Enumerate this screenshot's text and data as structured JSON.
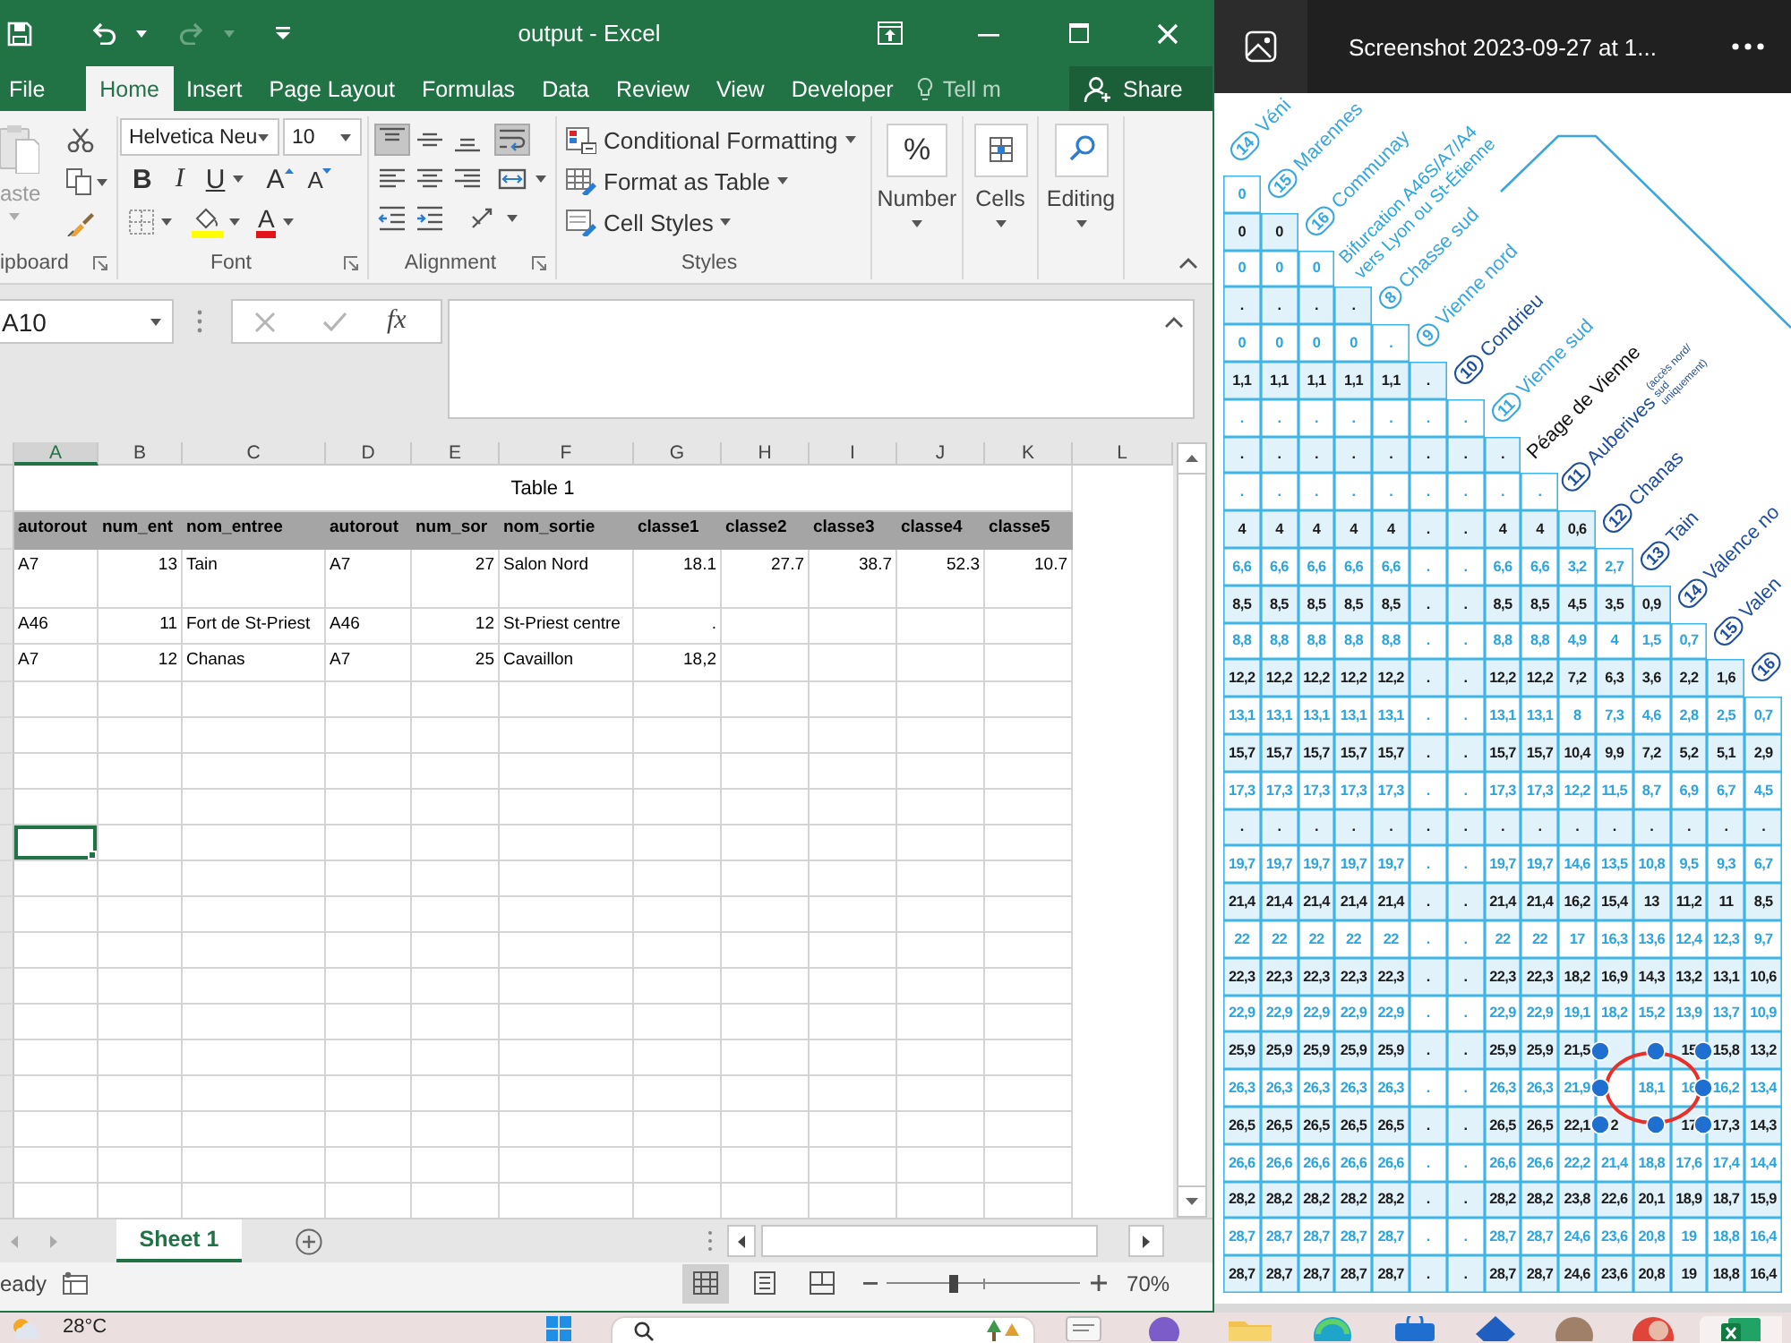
{
  "excel": {
    "title": "output - Excel",
    "tabs": [
      {
        "label": "File",
        "selected": false
      },
      {
        "label": "Home",
        "selected": true
      },
      {
        "label": "Insert",
        "selected": false
      },
      {
        "label": "Page Layout",
        "selected": false
      },
      {
        "label": "Formulas",
        "selected": false
      },
      {
        "label": "Data",
        "selected": false
      },
      {
        "label": "Review",
        "selected": false
      },
      {
        "label": "View",
        "selected": false
      },
      {
        "label": "Developer",
        "selected": false
      }
    ],
    "tell_me": "Tell m",
    "share": "Share",
    "clipboard": {
      "paste": "aste",
      "label": "ipboard"
    },
    "font": {
      "name": "Helvetica Neu",
      "size": "10",
      "bold": "B",
      "italic": "I",
      "underline": "U",
      "grow": "A",
      "shrink": "A",
      "font_color_button": "A",
      "label": "Font"
    },
    "alignment": {
      "buttons": [
        {
          "kind": "top",
          "selected": true
        },
        {
          "kind": "middle",
          "selected": false
        },
        {
          "kind": "bottom",
          "selected": false
        },
        {
          "kind": "wrap",
          "selected": true
        },
        {
          "kind": "left",
          "selected": false
        },
        {
          "kind": "center",
          "selected": false
        },
        {
          "kind": "right",
          "selected": false
        },
        {
          "kind": "merge",
          "selected": false
        },
        {
          "kind": "outdent",
          "selected": false
        },
        {
          "kind": "indent",
          "selected": false
        },
        {
          "kind": "orientation",
          "selected": false
        }
      ],
      "label": "Alignment"
    },
    "styles": {
      "items": [
        "Conditional Formatting",
        "Format as Table",
        "Cell Styles"
      ],
      "label": "Styles"
    },
    "number": {
      "symbol": "%",
      "label": "Number"
    },
    "cells": {
      "label": "Cells"
    },
    "editing": {
      "label": "Editing"
    },
    "formula_bar": {
      "name_box": "A10",
      "function_label": "fx"
    },
    "columns": [
      {
        "label": "A",
        "selected": true
      },
      {
        "label": "B",
        "selected": false
      },
      {
        "label": "C",
        "selected": false
      },
      {
        "label": "D",
        "selected": false
      },
      {
        "label": "E",
        "selected": false
      },
      {
        "label": "F",
        "selected": false
      },
      {
        "label": "G",
        "selected": false
      },
      {
        "label": "H",
        "selected": false
      },
      {
        "label": "I",
        "selected": false
      },
      {
        "label": "J",
        "selected": false
      },
      {
        "label": "K",
        "selected": false
      },
      {
        "label": "L",
        "selected": false
      }
    ],
    "sheet": {
      "title": "Table 1",
      "header": [
        "autorout",
        "num_ent",
        "nom_entree",
        "autorout",
        "num_sor",
        "nom_sortie",
        "classe1",
        "classe2",
        "classe3",
        "classe4",
        "classe5"
      ],
      "rows": [
        [
          "A7",
          "13",
          "Tain",
          "A7",
          "27",
          "Salon Nord",
          "18.1",
          "27.7",
          "38.7",
          "52.3",
          "10.7"
        ],
        [
          "A46",
          "11",
          "Fort de St-Priest",
          "A46",
          "12",
          "St-Priest centre",
          ".",
          null,
          null,
          null,
          null
        ],
        [
          "A7",
          "12",
          "Chanas",
          "A7",
          "25",
          "Cavaillon",
          "18,2",
          null,
          null,
          null,
          null
        ]
      ],
      "empty_rows": [
        {
          "selected": false
        },
        {
          "selected": false
        },
        {
          "selected": false
        },
        {
          "selected": false
        },
        {
          "selected": true
        },
        {
          "selected": false
        },
        {
          "selected": false
        },
        {
          "selected": false
        },
        {
          "selected": false
        },
        {
          "selected": false
        },
        {
          "selected": false
        },
        {
          "selected": false
        },
        {
          "selected": false
        },
        {
          "selected": false
        },
        {
          "selected": false
        }
      ]
    },
    "sheet_tabs": [
      {
        "label": "Sheet 1",
        "selected": true
      }
    ],
    "status": "eady",
    "views": [
      {
        "kind": "normal",
        "selected": true
      },
      {
        "kind": "page-layout",
        "selected": false
      },
      {
        "kind": "page-break",
        "selected": false
      }
    ],
    "zoom": {
      "level": 0.35,
      "reading": "70%"
    }
  },
  "viewer": {
    "title": "Screenshot 2023-09-27 at 1...",
    "labels": [
      {
        "kind": "exit",
        "number": "14",
        "name": "Véni"
      },
      {
        "kind": "exit",
        "number": "15",
        "name": "Marennes"
      },
      {
        "kind": "exit",
        "number": "16",
        "name": "Communay"
      },
      {
        "kind": "junction",
        "lines": [
          "Bifurcation A46S/A7/A4",
          "vers Lyon ou St-Étienne"
        ]
      },
      {
        "kind": "exit",
        "number": "8",
        "name": "Chasse sud"
      },
      {
        "kind": "exit",
        "number": "9",
        "name": "Vienne nord"
      },
      {
        "kind": "major",
        "number": "10",
        "name": "Condrieu"
      },
      {
        "kind": "exit",
        "number": "11",
        "name": "Vienne sud"
      },
      {
        "kind": "toll",
        "name": "Péage de Vienne"
      },
      {
        "kind": "major",
        "number": "11",
        "name": "Auberives",
        "note": "(accès nord/ sud uniquement)"
      },
      {
        "kind": "major",
        "number": "12",
        "name": "Chanas"
      },
      {
        "kind": "major",
        "number": "13",
        "name": "Tain"
      },
      {
        "kind": "major",
        "number": "14",
        "name": "Valence no"
      },
      {
        "kind": "major",
        "number": "15",
        "name": "Valen"
      },
      {
        "kind": "major",
        "number": "16"
      }
    ],
    "rows": [
      {
        "shaded": false,
        "cells": [
          "0"
        ]
      },
      {
        "shaded": true,
        "cells": [
          "0",
          "0"
        ]
      },
      {
        "shaded": false,
        "cells": [
          "0",
          "0",
          "0"
        ]
      },
      {
        "shaded": true,
        "cells": [
          ".",
          ".",
          ".",
          "."
        ]
      },
      {
        "shaded": false,
        "cells": [
          "0",
          "0",
          "0",
          "0",
          "."
        ]
      },
      {
        "shaded": true,
        "cells": [
          "1,1",
          "1,1",
          "1,1",
          "1,1",
          "1,1",
          "."
        ]
      },
      {
        "shaded": false,
        "cells": [
          ".",
          ".",
          ".",
          ".",
          ".",
          ".",
          "."
        ]
      },
      {
        "shaded": true,
        "cells": [
          ".",
          ".",
          ".",
          ".",
          ".",
          ".",
          ".",
          "."
        ]
      },
      {
        "shaded": false,
        "cells": [
          ".",
          ".",
          ".",
          ".",
          ".",
          ".",
          ".",
          ".",
          "."
        ]
      },
      {
        "shaded": true,
        "cells": [
          "4",
          "4",
          "4",
          "4",
          "4",
          ".",
          ".",
          "4",
          "4",
          "0,6"
        ]
      },
      {
        "shaded": false,
        "cells": [
          "6,6",
          "6,6",
          "6,6",
          "6,6",
          "6,6",
          ".",
          ".",
          "6,6",
          "6,6",
          "3,2",
          "2,7"
        ]
      },
      {
        "shaded": true,
        "cells": [
          "8,5",
          "8,5",
          "8,5",
          "8,5",
          "8,5",
          ".",
          ".",
          "8,5",
          "8,5",
          "4,5",
          "3,5",
          "0,9"
        ]
      },
      {
        "shaded": false,
        "cells": [
          "8,8",
          "8,8",
          "8,8",
          "8,8",
          "8,8",
          ".",
          ".",
          "8,8",
          "8,8",
          "4,9",
          "4",
          "1,5",
          "0,7"
        ]
      },
      {
        "shaded": true,
        "cells": [
          "12,2",
          "12,2",
          "12,2",
          "12,2",
          "12,2",
          ".",
          ".",
          "12,2",
          "12,2",
          "7,2",
          "6,3",
          "3,6",
          "2,2",
          "1,6"
        ]
      },
      {
        "shaded": false,
        "cells": [
          "13,1",
          "13,1",
          "13,1",
          "13,1",
          "13,1",
          ".",
          ".",
          "13,1",
          "13,1",
          "8",
          "7,3",
          "4,6",
          "2,8",
          "2,5",
          "0,7"
        ]
      },
      {
        "shaded": true,
        "cells": [
          "15,7",
          "15,7",
          "15,7",
          "15,7",
          "15,7",
          ".",
          ".",
          "15,7",
          "15,7",
          "10,4",
          "9,9",
          "7,2",
          "5,2",
          "5,1",
          "2,9"
        ]
      },
      {
        "shaded": false,
        "cells": [
          "17,3",
          "17,3",
          "17,3",
          "17,3",
          "17,3",
          ".",
          ".",
          "17,3",
          "17,3",
          "12,2",
          "11,5",
          "8,7",
          "6,9",
          "6,7",
          "4,5"
        ]
      },
      {
        "shaded": true,
        "cells": [
          ".",
          ".",
          ".",
          ".",
          ".",
          ".",
          ".",
          ".",
          ".",
          ".",
          ".",
          ".",
          ".",
          ".",
          "."
        ]
      },
      {
        "shaded": false,
        "cells": [
          "19,7",
          "19,7",
          "19,7",
          "19,7",
          "19,7",
          ".",
          ".",
          "19,7",
          "19,7",
          "14,6",
          "13,5",
          "10,8",
          "9,5",
          "9,3",
          "6,7"
        ]
      },
      {
        "shaded": true,
        "cells": [
          "21,4",
          "21,4",
          "21,4",
          "21,4",
          "21,4",
          ".",
          ".",
          "21,4",
          "21,4",
          "16,2",
          "15,4",
          "13",
          "11,2",
          "11",
          "8,5"
        ]
      },
      {
        "shaded": false,
        "cells": [
          "22",
          "22",
          "22",
          "22",
          "22",
          ".",
          ".",
          "22",
          "22",
          "17",
          "16,3",
          "13,6",
          "12,4",
          "12,3",
          "9,7"
        ]
      },
      {
        "shaded": true,
        "cells": [
          "22,3",
          "22,3",
          "22,3",
          "22,3",
          "22,3",
          ".",
          ".",
          "22,3",
          "22,3",
          "18,2",
          "16,9",
          "14,3",
          "13,2",
          "13,1",
          "10,6"
        ]
      },
      {
        "shaded": false,
        "cells": [
          "22,9",
          "22,9",
          "22,9",
          "22,9",
          "22,9",
          ".",
          ".",
          "22,9",
          "22,9",
          "19,1",
          "18,2",
          "15,2",
          "13,9",
          "13,7",
          "10,9"
        ]
      },
      {
        "shaded": true,
        "cells": [
          "25,9",
          "25,9",
          "25,9",
          "25,9",
          "25,9",
          ".",
          ".",
          "25,9",
          "25,9",
          "21,5",
          null,
          null,
          "15",
          "15,8",
          "13,2"
        ]
      },
      {
        "shaded": false,
        "cells": [
          "26,3",
          "26,3",
          "26,3",
          "26,3",
          "26,3",
          ".",
          ".",
          "26,3",
          "26,3",
          "21,9",
          null,
          "18,1",
          "16",
          "16,2",
          "13,4"
        ]
      },
      {
        "shaded": true,
        "cells": [
          "26,5",
          "26,5",
          "26,5",
          "26,5",
          "26,5",
          ".",
          ".",
          "26,5",
          "26,5",
          "22,1",
          "2",
          null,
          "17",
          "17,3",
          "14,3"
        ]
      },
      {
        "shaded": false,
        "cells": [
          "26,6",
          "26,6",
          "26,6",
          "26,6",
          "26,6",
          ".",
          ".",
          "26,6",
          "26,6",
          "22,2",
          "21,4",
          "18,8",
          "17,6",
          "17,4",
          "14,4"
        ]
      },
      {
        "shaded": true,
        "cells": [
          "28,2",
          "28,2",
          "28,2",
          "28,2",
          "28,2",
          ".",
          ".",
          "28,2",
          "28,2",
          "23,8",
          "22,6",
          "20,1",
          "18,9",
          "18,7",
          "15,9"
        ]
      },
      {
        "shaded": false,
        "cells": [
          "28,7",
          "28,7",
          "28,7",
          "28,7",
          "28,7",
          ".",
          ".",
          "28,7",
          "28,7",
          "24,6",
          "23,6",
          "20,8",
          "19",
          "18,8",
          "16,4"
        ]
      },
      {
        "shaded": true,
        "cells": [
          "28,7",
          "28,7",
          "28,7",
          "28,7",
          "28,7",
          ".",
          ".",
          "28,7",
          "28,7",
          "24,6",
          "23,6",
          "20,8",
          "19",
          "18,8",
          "16,4"
        ]
      }
    ]
  },
  "taskbar": {
    "weather": "28°C"
  }
}
